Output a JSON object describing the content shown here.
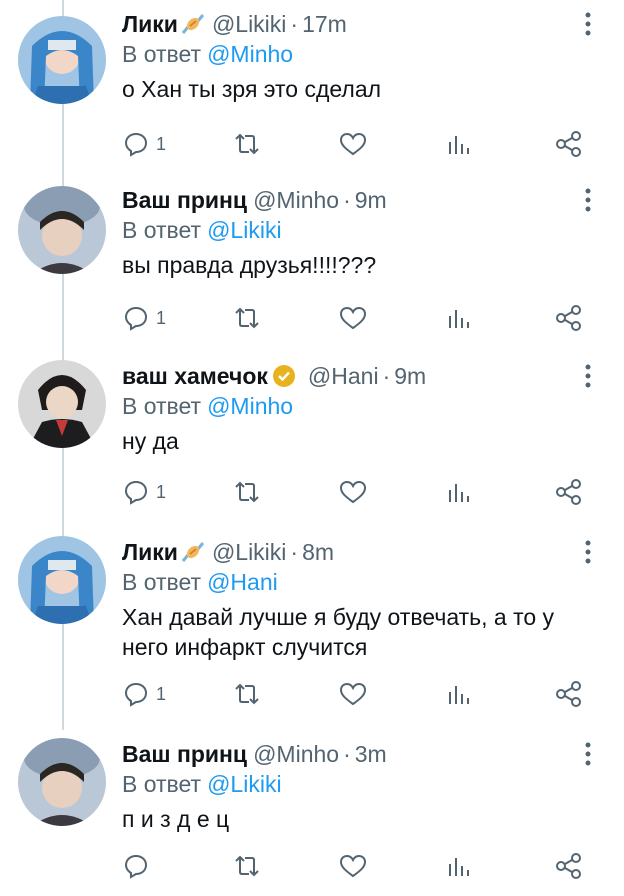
{
  "colors": {
    "accent": "#1d9bf0",
    "muted": "#536471",
    "text": "#0f1419",
    "thread": "#cfd9de"
  },
  "tweets": [
    {
      "name": "Лики",
      "emoji": "candy-icon",
      "handle": "@Likiki",
      "time": "17m",
      "reply_prefix": "В ответ",
      "reply_to": "@Minho",
      "text": "о Хан ты зря это сделал",
      "reply_count": "1"
    },
    {
      "name": "Ваш принц",
      "handle": "@Minho",
      "time": "9m",
      "reply_prefix": "В ответ",
      "reply_to": "@Likiki",
      "text": "вы правда друзья!!!!???",
      "reply_count": "1"
    },
    {
      "name": "ваш хамечок",
      "verified": true,
      "handle": "@Hani",
      "time": "9m",
      "reply_prefix": "В ответ",
      "reply_to": "@Minho",
      "text": "ну да",
      "reply_count": "1"
    },
    {
      "name": "Лики",
      "emoji": "candy-icon",
      "handle": "@Likiki",
      "time": "8m",
      "reply_prefix": "В ответ",
      "reply_to": "@Hani",
      "text": "Хан давай лучше я буду отвечать, а то у него инфаркт случится",
      "reply_count": "1"
    },
    {
      "name": "Ваш принц",
      "handle": "@Minho",
      "time": "3m",
      "reply_prefix": "В ответ",
      "reply_to": "@Likiki",
      "text": "п и з д е ц",
      "reply_count": ""
    }
  ],
  "separator": "·"
}
